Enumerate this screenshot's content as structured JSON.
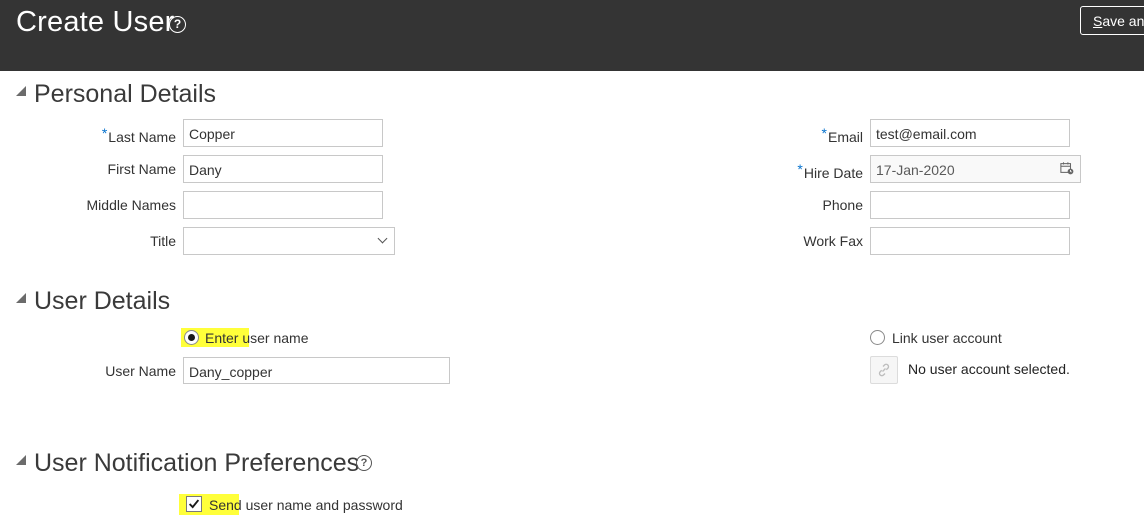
{
  "header": {
    "title": "Create User",
    "save_label_underlined": "S",
    "save_label_rest": "ave and"
  },
  "personal_details": {
    "section_title": "Personal Details",
    "last_name": {
      "label": "Last Name",
      "value": "Copper",
      "required": "*"
    },
    "first_name": {
      "label": "First Name",
      "value": "Dany"
    },
    "middle_names": {
      "label": "Middle Names",
      "value": ""
    },
    "title": {
      "label": "Title",
      "value": ""
    },
    "email": {
      "label": "Email",
      "value": "test@email.com",
      "required": "*"
    },
    "hire_date": {
      "label": "Hire Date",
      "value": "17-Jan-2020",
      "required": "*"
    },
    "phone": {
      "label": "Phone",
      "value": ""
    },
    "work_fax": {
      "label": "Work Fax",
      "value": ""
    }
  },
  "user_details": {
    "section_title": "User Details",
    "enter_user_name_label": "Enter user name",
    "link_user_account_label": "Link user account",
    "user_name": {
      "label": "User Name",
      "value": "Dany_copper"
    },
    "no_account_text": "No user account selected."
  },
  "notification_prefs": {
    "section_title": "User Notification Preferences",
    "send_label": "Send user name and password"
  },
  "colors": {
    "header_bg": "#343434",
    "required_star": "#0572ce",
    "highlight": "#ffff3a"
  },
  "icons": {
    "help": "help-circle-icon",
    "calendar": "calendar-icon",
    "link": "link-icon",
    "section_toggle": "triangle-collapse-icon"
  }
}
